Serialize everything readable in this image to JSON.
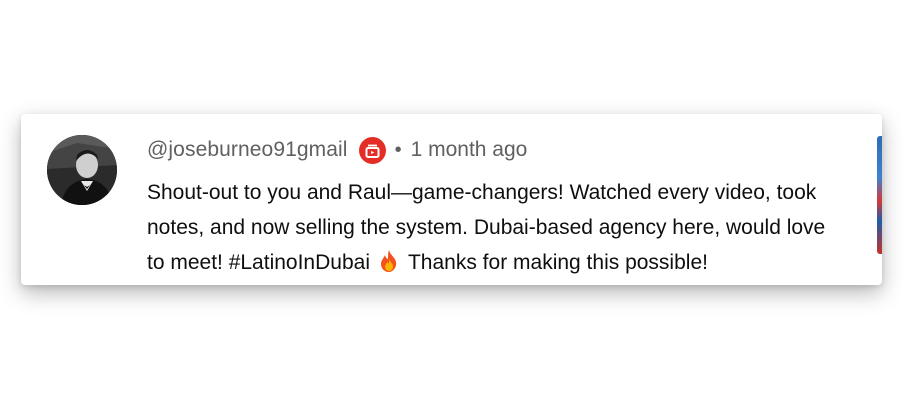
{
  "comment": {
    "handle": "@joseburneo91gmail",
    "badge_icon": "member-badge-icon",
    "separator": "•",
    "timestamp": "1 month ago",
    "body_lines": [
      "Shout-out to you and Raul—game-changers! Watched every video, took",
      "notes, and now selling the system. Dubai-based agency here, would love",
      "to meet! #LatinoInDubai",
      "Thanks for making this possible!"
    ],
    "emoji_icon": "fire-icon"
  },
  "colors": {
    "meta_text": "#606060",
    "body_text": "#0f0f0f",
    "badge_red": "#e52d27"
  }
}
